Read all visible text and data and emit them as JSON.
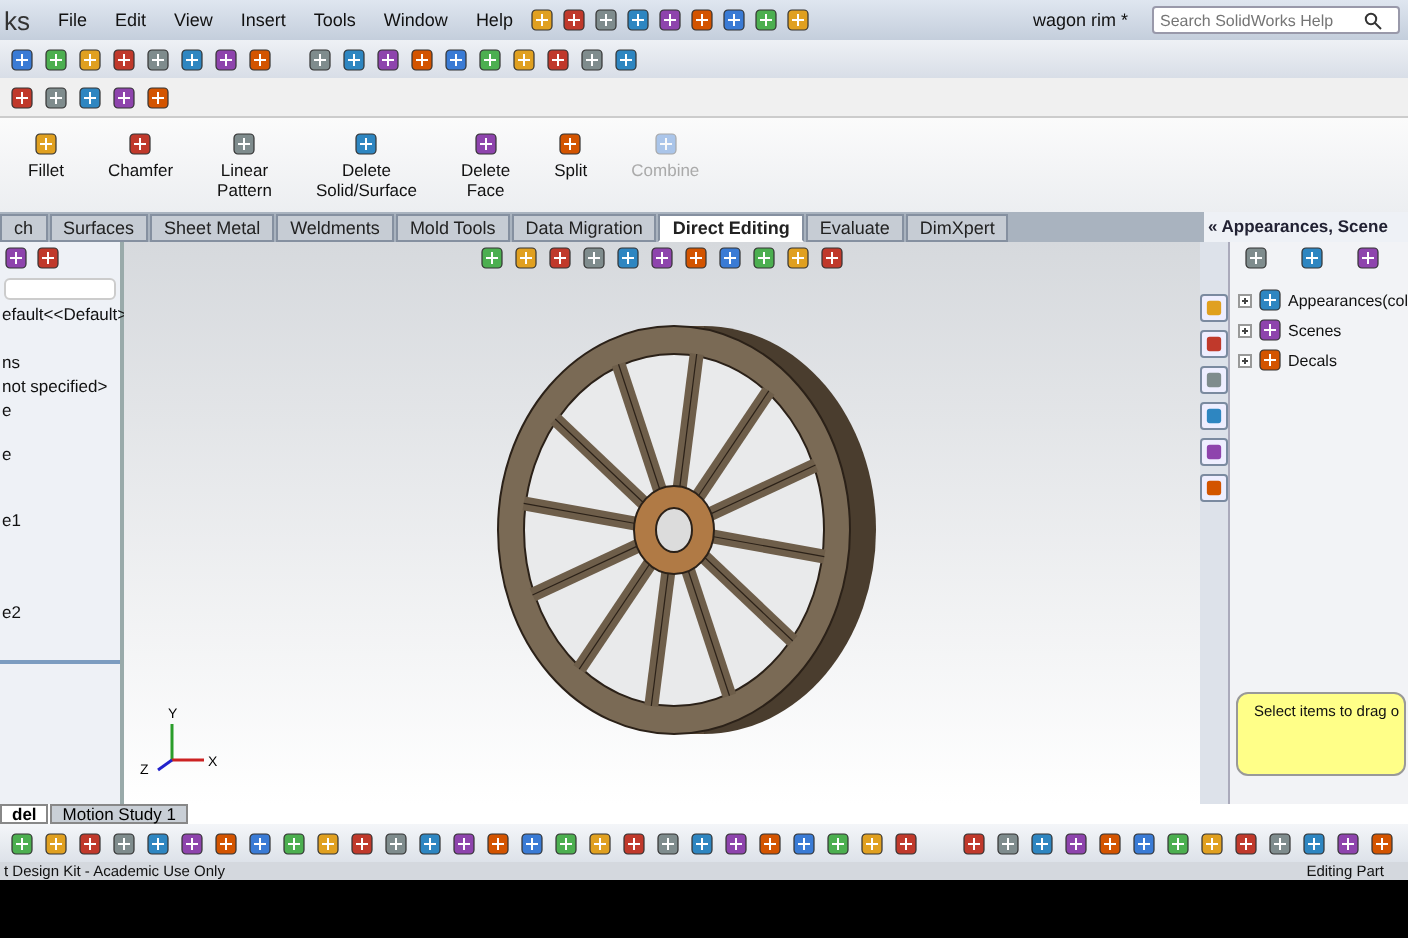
{
  "app_title": "ks",
  "menu": [
    "File",
    "Edit",
    "View",
    "Insert",
    "Tools",
    "Window",
    "Help"
  ],
  "document_title": "wagon rim *",
  "search": {
    "placeholder": "Search SolidWorks Help"
  },
  "ribbon": [
    {
      "label": "Fillet",
      "disabled": false
    },
    {
      "label": "Chamfer",
      "disabled": false
    },
    {
      "label": "Linear\nPattern",
      "disabled": false
    },
    {
      "label": "Delete\nSolid/Surface",
      "disabled": false
    },
    {
      "label": "Delete\nFace",
      "disabled": false
    },
    {
      "label": "Split",
      "disabled": false
    },
    {
      "label": "Combine",
      "disabled": true
    }
  ],
  "tabs": [
    {
      "label": "ch",
      "selected": false
    },
    {
      "label": "Surfaces",
      "selected": false
    },
    {
      "label": "Sheet Metal",
      "selected": false
    },
    {
      "label": "Weldments",
      "selected": false
    },
    {
      "label": "Mold Tools",
      "selected": false
    },
    {
      "label": "Data Migration",
      "selected": false
    },
    {
      "label": "Direct Editing",
      "selected": true
    },
    {
      "label": "Evaluate",
      "selected": false
    },
    {
      "label": "DimXpert",
      "selected": false
    }
  ],
  "feature_tree": {
    "items": [
      "efault<<Default>",
      "ns",
      "not specified>",
      "e",
      "e",
      "e1",
      "e2"
    ]
  },
  "triad": {
    "x": "X",
    "y": "Y",
    "z": "Z"
  },
  "task_pane": {
    "title": "« Appearances, Scene",
    "items": [
      {
        "label": "Appearances(col",
        "expanded": false
      },
      {
        "label": "Scenes",
        "expanded": false
      },
      {
        "label": "Decals",
        "expanded": false
      }
    ],
    "hint": "Select items to drag o"
  },
  "bottom_tabs": [
    {
      "label": "del",
      "selected": true
    },
    {
      "label": "Motion Study 1",
      "selected": false
    }
  ],
  "status_bar": {
    "left": "t Design Kit - Academic Use Only",
    "right": "Editing Part"
  }
}
